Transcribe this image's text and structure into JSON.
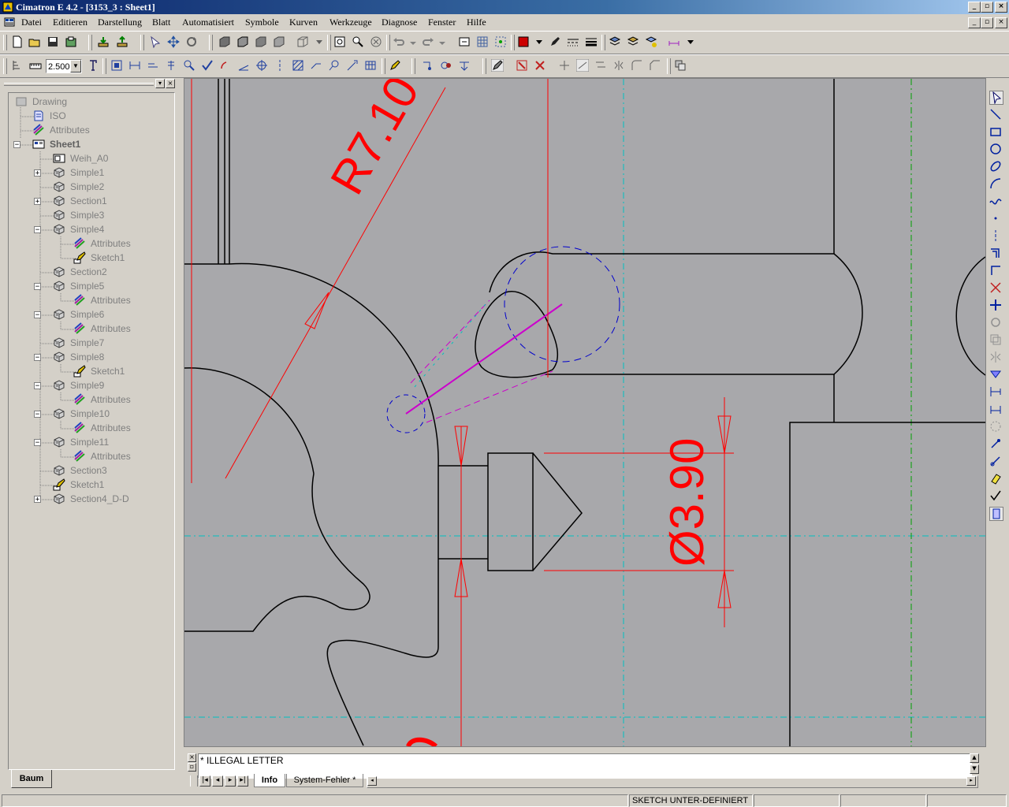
{
  "window": {
    "title": "Cimatron E 4.2 - [3153_3 : Sheet1]"
  },
  "menu": {
    "items": [
      "Datei",
      "Editieren",
      "Darstellung",
      "Blatt",
      "Automatisiert",
      "Symbole",
      "Kurven",
      "Werkzeuge",
      "Diagnose",
      "Fenster",
      "Hilfe"
    ]
  },
  "toolbar": {
    "scale_value": "2.500",
    "accent_color": "#cc0000"
  },
  "tree": {
    "nodes": [
      {
        "label": "Drawing",
        "icon": "drawing-icon"
      },
      {
        "label": "ISO",
        "icon": "standard-icon"
      },
      {
        "label": "Attributes",
        "icon": "attributes-icon"
      },
      {
        "label": "Sheet1",
        "icon": "sheet-icon",
        "bold": true
      },
      {
        "label": "Weih_A0",
        "icon": "frame-icon"
      },
      {
        "label": "Simple1",
        "icon": "view-icon"
      },
      {
        "label": "Simple2",
        "icon": "view-icon"
      },
      {
        "label": "Section1",
        "icon": "view-icon"
      },
      {
        "label": "Simple3",
        "icon": "view-icon"
      },
      {
        "label": "Simple4",
        "icon": "view-icon"
      },
      {
        "label": "Attributes",
        "icon": "attributes-icon"
      },
      {
        "label": "Sketch1",
        "icon": "sketch-icon"
      },
      {
        "label": "Section2",
        "icon": "view-icon"
      },
      {
        "label": "Simple5",
        "icon": "view-icon"
      },
      {
        "label": "Attributes",
        "icon": "attributes-icon"
      },
      {
        "label": "Simple6",
        "icon": "view-icon"
      },
      {
        "label": "Attributes",
        "icon": "attributes-icon"
      },
      {
        "label": "Simple7",
        "icon": "view-icon"
      },
      {
        "label": "Simple8",
        "icon": "view-icon"
      },
      {
        "label": "Sketch1",
        "icon": "sketch-icon"
      },
      {
        "label": "Simple9",
        "icon": "view-icon"
      },
      {
        "label": "Attributes",
        "icon": "attributes-icon"
      },
      {
        "label": "Simple10",
        "icon": "view-icon"
      },
      {
        "label": "Attributes",
        "icon": "attributes-icon"
      },
      {
        "label": "Simple11",
        "icon": "view-icon"
      },
      {
        "label": "Attributes",
        "icon": "attributes-icon"
      },
      {
        "label": "Section3",
        "icon": "view-icon"
      },
      {
        "label": "Sketch1",
        "icon": "sketch-icon"
      },
      {
        "label": "Section4_D-D",
        "icon": "view-icon"
      }
    ],
    "tab_label": "Baum"
  },
  "drawing": {
    "dim_radius": "R7.10",
    "dim_diameter": "Ø3.90",
    "dim_color": "#ff0000",
    "sketch_color": "#cc00cc",
    "centerline_color": "#00c0c0",
    "construction_color": "#0000cc"
  },
  "console": {
    "message": "* ILLEGAL LETTER",
    "tabs": [
      "Info",
      "System-Fehler *"
    ]
  },
  "status": {
    "text": "SKETCH UNTER-DEFINIERT"
  }
}
